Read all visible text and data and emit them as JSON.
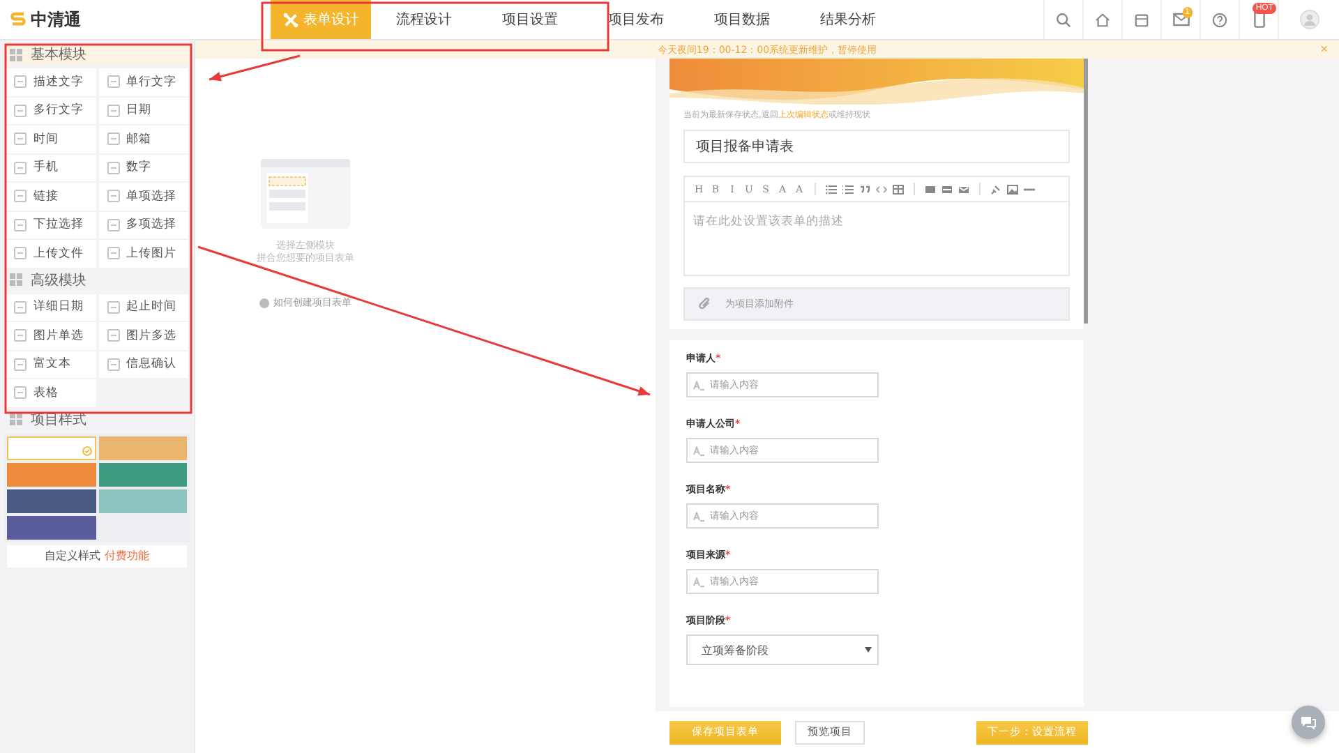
{
  "logo": {
    "text": "中清通"
  },
  "nav_tabs": [
    {
      "label": "表单设计",
      "selected": true
    },
    {
      "label": "流程设计",
      "selected": false
    },
    {
      "label": "项目设置",
      "selected": false
    },
    {
      "label": "项目发布",
      "selected": false
    },
    {
      "label": "项目数据",
      "selected": false
    },
    {
      "label": "结果分析",
      "selected": false
    }
  ],
  "header_icons": [
    {
      "kind": "search"
    },
    {
      "kind": "home"
    },
    {
      "kind": "store"
    },
    {
      "kind": "mail",
      "badge": "1"
    },
    {
      "kind": "help"
    },
    {
      "kind": "phone",
      "badge": "HOT"
    },
    {
      "kind": "avatar"
    }
  ],
  "notice": {
    "text": "今天夜间19：00-12：00系统更新维护，暂停使用",
    "close": "×"
  },
  "palette": [
    {
      "title": "基本模块",
      "items": [
        "描述文字",
        "单行文字",
        "多行文字",
        "日期",
        "时间",
        "邮箱",
        "手机",
        "数字",
        "链接",
        "单项选择",
        "下拉选择",
        "多项选择",
        "上传文件",
        "上传图片"
      ]
    },
    {
      "title": "高级模块",
      "items": [
        "详细日期",
        "起止时间",
        "图片单选",
        "图片多选",
        "富文本",
        "信息确认",
        "表格"
      ]
    }
  ],
  "styles": {
    "title": "项目样式",
    "themes": [
      {
        "selected": true,
        "color": "#ffffff"
      },
      {
        "selected": false,
        "color": "#eab56c"
      },
      {
        "selected": false,
        "color": "#ee8a3c"
      },
      {
        "selected": false,
        "color": "#3e9a80"
      },
      {
        "selected": false,
        "color": "#4a5a80"
      },
      {
        "selected": false,
        "color": "#8cc4c0"
      },
      {
        "selected": false,
        "color": "#5a5c9c"
      }
    ],
    "custom_label": "自定义样式",
    "custom_link": "付费功能"
  },
  "canvas": {
    "hint": [
      "选择左侧模块",
      "拼合您想要的项目表单"
    ],
    "help_link": "如何创建项目表单"
  },
  "form": {
    "tip_before": "当前为最新保存状态,返回",
    "tip_link": "上次编辑状态",
    "tip_after": "或维持现状",
    "title": "项目报备申请表",
    "editor_tools": [
      "H",
      "B",
      "I",
      "U",
      "S",
      "A",
      "A"
    ],
    "description_placeholder": "请在此处设置该表单的描述",
    "attachment": "为项目添加附件",
    "fields": [
      {
        "label": "申请人",
        "required_mark": "*",
        "kind": "text",
        "placeholder": "请输入内容"
      },
      {
        "label": "申请人公司",
        "required_mark": "*",
        "kind": "text",
        "placeholder": "请输入内容"
      },
      {
        "label": "项目名称",
        "required_mark": "*",
        "kind": "text",
        "placeholder": "请输入内容"
      },
      {
        "label": "项目来源",
        "required_mark": "*",
        "kind": "text",
        "placeholder": "请输入内容"
      },
      {
        "label": "项目阶段",
        "required_mark": "*",
        "kind": "select",
        "value": "立项筹备阶段"
      }
    ]
  },
  "footer": {
    "save": "保存项目表单",
    "preview": "预览项目",
    "next": "下一步：设置流程"
  },
  "annotations": [
    {
      "kind": "box"
    },
    {
      "kind": "box"
    },
    {
      "kind": "arrow"
    },
    {
      "kind": "arrow"
    }
  ]
}
